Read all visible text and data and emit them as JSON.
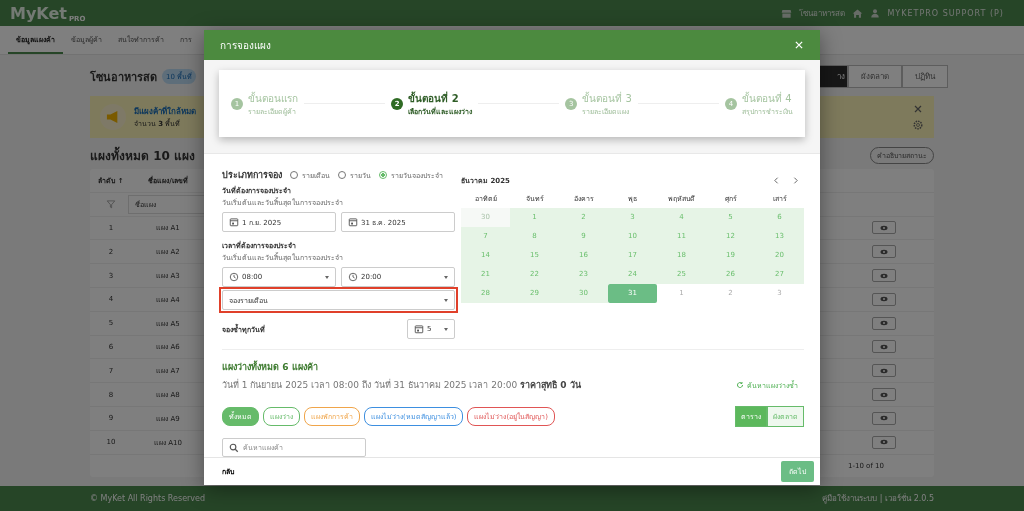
{
  "app_bar": {
    "logo": "MyKet",
    "logo_sub": "PRO",
    "zone": "โซนอาหารสด",
    "user": "MYKETPRO SUPPORT (P)"
  },
  "nav_tabs": [
    {
      "label": "ข้อมูลแผงค้า",
      "selected": true
    },
    {
      "label": "ข้อมูลผู้ค้า",
      "selected": false
    },
    {
      "label": "สนใจทำการค้า",
      "selected": false
    },
    {
      "label": "การ",
      "selected": false
    }
  ],
  "page": {
    "title": "โซนอาหารสด",
    "badge": "10 พื้นที่",
    "views": [
      {
        "label": "าง",
        "selected": true
      },
      {
        "label": "ผังตลาด",
        "selected": false
      },
      {
        "label": "ปฏิทิน",
        "selected": false
      }
    ]
  },
  "alert": {
    "title": "มีแผงค้าที่ใกล้หมด",
    "text": "จำนวน **3** พื้นที่"
  },
  "stalls": {
    "heading": "แผงทั้งหมด 10 แผง",
    "legend_button": "คำอธิบายสถานะ",
    "columns": [
      "ลำดับ ↑",
      "ชื่อแผง/เลขที่"
    ],
    "filter_placeholder": "ชื่อแผง",
    "rows": [
      {
        "no": "1",
        "name": "แผง A1"
      },
      {
        "no": "2",
        "name": "แผง A2"
      },
      {
        "no": "3",
        "name": "แผง A3"
      },
      {
        "no": "4",
        "name": "แผง A4"
      },
      {
        "no": "5",
        "name": "แผง A5"
      },
      {
        "no": "6",
        "name": "แผง A6"
      },
      {
        "no": "7",
        "name": "แผง A7"
      },
      {
        "no": "8",
        "name": "แผง A8"
      },
      {
        "no": "9",
        "name": "แผง A9"
      },
      {
        "no": "10",
        "name": "แผง A10"
      }
    ],
    "pagination": "1-10 of 10"
  },
  "footer": {
    "copyright": "© MyKet All Rights Reserved",
    "links": "คู่มือใช้งานระบบ | เวอร์ชั่น 2.0.5"
  },
  "dialog": {
    "title": "การจองแผง",
    "steps": [
      {
        "number": "1",
        "title": "ขั้นตอนแรก",
        "subtitle": "รายละเอียดผู้ค้า",
        "selected": false
      },
      {
        "number": "2",
        "title": "ขั้นตอนที่ 2",
        "subtitle": "เลือกวันที่และแผงว่าง",
        "selected": true
      },
      {
        "number": "3",
        "title": "ขั้นตอนที่ 3",
        "subtitle": "รายละเอียดแผง",
        "selected": false
      },
      {
        "number": "4",
        "title": "ขั้นตอนที่ 4",
        "subtitle": "สรุปการชำระเงิน",
        "selected": false
      }
    ],
    "booking_type": {
      "label": "ประเภทการจอง",
      "options": [
        {
          "label": "รายเดือน",
          "selected": false
        },
        {
          "label": "รายวัน",
          "selected": false
        },
        {
          "label": "รายวันจองประจำ",
          "selected": true
        }
      ]
    },
    "date_range": {
      "label": "วันที่ต้องการจองประจำ",
      "hint": "วันเริ่มต้นและวันสิ้นสุดในการจองประจำ",
      "start": "1 ก.ย. 2025",
      "end": "31 ธ.ค. 2025"
    },
    "time_range": {
      "label": "เวลาที่ต้องการจองประจำ",
      "hint": "วันเริ่มต้นและวันสิ้นสุดในการจองประจำ",
      "start": "08:00",
      "end": "20:00"
    },
    "repeat_select": {
      "value": "จองรายเดือน",
      "highlighted": true
    },
    "repeat_day": {
      "label": "จองซ้ำทุกวันที่",
      "value": "5"
    },
    "calendar": {
      "month": "ธันวาคม 2025",
      "weekdays": [
        "อาทิตย์",
        "จันทร์",
        "อังคาร",
        "พุธ",
        "พฤหัสบดี",
        "ศุกร์",
        "เสาร์"
      ],
      "days": [
        {
          "label": "30",
          "kind": "muted"
        },
        {
          "label": "1",
          "kind": "range"
        },
        {
          "label": "2",
          "kind": "range"
        },
        {
          "label": "3",
          "kind": "range"
        },
        {
          "label": "4",
          "kind": "range"
        },
        {
          "label": "5",
          "kind": "range"
        },
        {
          "label": "6",
          "kind": "range"
        },
        {
          "label": "7",
          "kind": "range"
        },
        {
          "label": "8",
          "kind": "range"
        },
        {
          "label": "9",
          "kind": "range"
        },
        {
          "label": "10",
          "kind": "range"
        },
        {
          "label": "11",
          "kind": "range"
        },
        {
          "label": "12",
          "kind": "range"
        },
        {
          "label": "13",
          "kind": "range"
        },
        {
          "label": "14",
          "kind": "range"
        },
        {
          "label": "15",
          "kind": "range"
        },
        {
          "label": "16",
          "kind": "range"
        },
        {
          "label": "17",
          "kind": "range"
        },
        {
          "label": "18",
          "kind": "range"
        },
        {
          "label": "19",
          "kind": "range"
        },
        {
          "label": "20",
          "kind": "range"
        },
        {
          "label": "21",
          "kind": "range"
        },
        {
          "label": "22",
          "kind": "range"
        },
        {
          "label": "23",
          "kind": "range"
        },
        {
          "label": "24",
          "kind": "range"
        },
        {
          "label": "25",
          "kind": "range"
        },
        {
          "label": "26",
          "kind": "range"
        },
        {
          "label": "27",
          "kind": "range"
        },
        {
          "label": "28",
          "kind": "range"
        },
        {
          "label": "29",
          "kind": "range"
        },
        {
          "label": "30",
          "kind": "range"
        },
        {
          "label": "31",
          "kind": "end"
        },
        {
          "label": "1",
          "kind": "other"
        },
        {
          "label": "2",
          "kind": "other"
        },
        {
          "label": "3",
          "kind": "other"
        }
      ]
    },
    "available": {
      "title": "แผงว่างทั้งหมด 6 แผงค้า",
      "summary": "วันที่ 1 กันยายน 2025 เวลา 08:00 ถึง วันที่ 31 ธันวาคม 2025 เวลา 20:00 **ราคาสุทธิ 0 วัน**",
      "refresh": "ค้นหาแผงว่างซ้ำ",
      "filters": [
        {
          "label": "ทั้งหมด",
          "selected": true,
          "color": "#66bb6a"
        },
        {
          "label": "แผงว่าง",
          "selected": false,
          "color": "#66bb6a"
        },
        {
          "label": "แผงพักการค้า",
          "selected": false,
          "color": "#f0a54a"
        },
        {
          "label": "แผงไม่ว่าง(หมดสัญญาแล้ว)",
          "selected": false,
          "color": "#3d8fe0"
        },
        {
          "label": "แผงไม่ว่าง(อยู่ในสัญญา)",
          "selected": false,
          "color": "#e05555"
        }
      ],
      "views": [
        {
          "label": "ตาราง",
          "selected": true
        },
        {
          "label": "ผังตลาด",
          "selected": false
        }
      ],
      "search_placeholder": "ค้นหาแผงค้า"
    },
    "actions": {
      "back": "กลับ",
      "next": "ถัดไป"
    }
  }
}
